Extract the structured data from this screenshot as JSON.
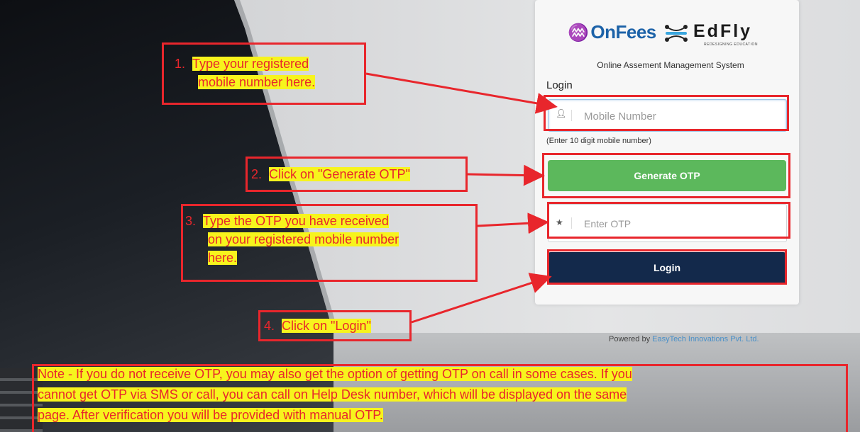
{
  "login": {
    "brand_onfees": "OnFees",
    "brand_edfly": "EdFly",
    "brand_edfly_tagline": "REDESIGNING EDUCATION",
    "system_title": "Online Assement Management System",
    "heading": "Login",
    "mobile_placeholder": "Mobile Number",
    "mobile_hint": "(Enter 10 digit mobile number)",
    "generate_otp_label": "Generate OTP",
    "otp_placeholder": "Enter OTP",
    "login_label": "Login",
    "powered_prefix": "Powered by",
    "powered_company": "EasyTech Innovations Pvt. Ltd."
  },
  "icons": {
    "mobile_field": "user-icon",
    "otp_field": "star-icon"
  },
  "annotations": {
    "step1_number": "1.",
    "step1_line1": "Type your registered",
    "step1_line2": "mobile number here.",
    "step2_number": "2.",
    "step2_text": "Click on \"Generate OTP\"",
    "step3_number": "3.",
    "step3_line1": "Type the OTP you have received",
    "step3_line2": "on your registered mobile number",
    "step3_line3": "here.",
    "step4_number": "4.",
    "step4_text": "Click on \"Login\"",
    "note_line1": "Note - If you do not receive OTP, you may also get the option of getting OTP on call in some cases. If you",
    "note_line2": "cannot get OTP via SMS or call, you can call on Help Desk number, which will be displayed on the same",
    "note_line3": "page. After verification you will be provided with manual OTP."
  },
  "colors": {
    "annotation_red": "#e8262c",
    "highlight_yellow": "#f7f41d",
    "generate_green": "#5cb85c",
    "login_navy": "#13294b",
    "onfees_blue": "#1c62a8"
  }
}
